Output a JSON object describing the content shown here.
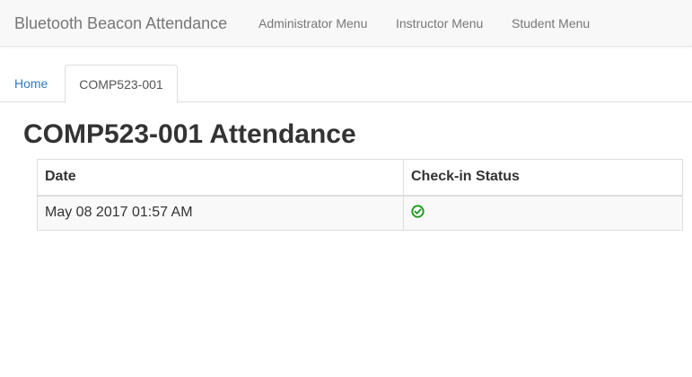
{
  "navbar": {
    "brand": "Bluetooth Beacon Attendance",
    "links": [
      "Administrator Menu",
      "Instructor Menu",
      "Student Menu"
    ]
  },
  "tabs": {
    "home": "Home",
    "active": "COMP523-001"
  },
  "page": {
    "title": "COMP523-001 Attendance"
  },
  "table": {
    "headers": [
      "Date",
      "Check-in Status"
    ],
    "rows": [
      {
        "date": "May 08 2017 01:57 AM",
        "status_icon": "check-circle-icon",
        "status_color": "#1a9a1a"
      }
    ]
  }
}
